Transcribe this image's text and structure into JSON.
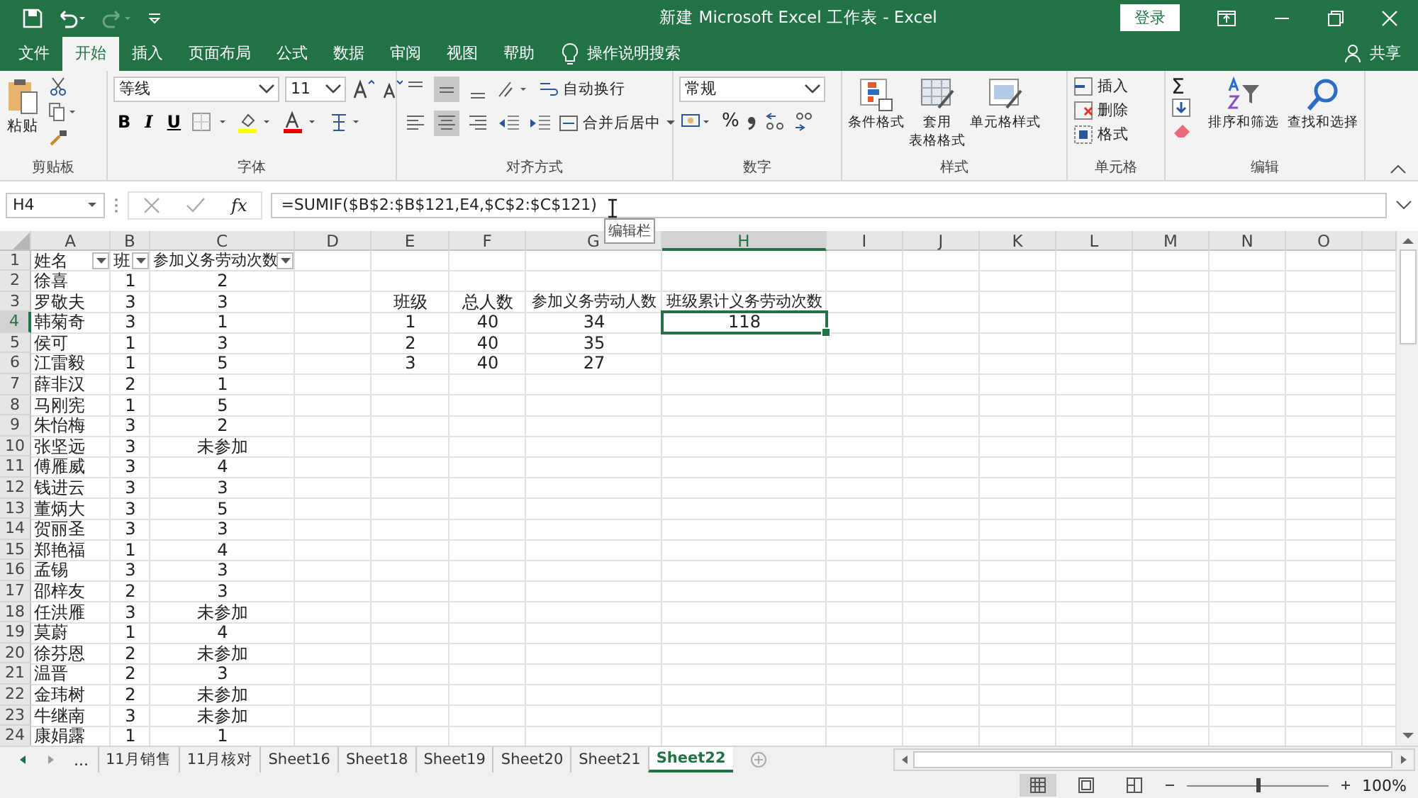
{
  "title_bar": {
    "title": "新建 Microsoft Excel 工作表  -  Excel",
    "login": "登录"
  },
  "menu_tabs": [
    {
      "label": "文件",
      "selected": false
    },
    {
      "label": "开始",
      "selected": true
    },
    {
      "label": "插入",
      "selected": false
    },
    {
      "label": "页面布局",
      "selected": false
    },
    {
      "label": "公式",
      "selected": false
    },
    {
      "label": "数据",
      "selected": false
    },
    {
      "label": "审阅",
      "selected": false
    },
    {
      "label": "视图",
      "selected": false
    },
    {
      "label": "帮助",
      "selected": false
    }
  ],
  "tell_me": "操作说明搜索",
  "share": "共享",
  "ribbon": {
    "clipboard": {
      "paste": "粘贴",
      "group": "剪贴板"
    },
    "font": {
      "name": "等线",
      "size": "11",
      "styles": [
        "B",
        "I",
        "U"
      ],
      "group": "字体"
    },
    "alignment": {
      "vertical": [
        {
          "selected": false
        },
        {
          "selected": true
        },
        {
          "selected": false
        }
      ],
      "horizontal": [
        {
          "selected": false
        },
        {
          "selected": true
        },
        {
          "selected": false
        }
      ],
      "wrap": "自动换行",
      "merge": "合并后居中",
      "group": "对齐方式"
    },
    "number": {
      "format": "常规",
      "percent": "%",
      "group": "数字"
    },
    "styles": {
      "conditional": "条件格式",
      "table_format": [
        "套用",
        "表格格式"
      ],
      "cell_styles": "单元格样式",
      "group": "样式"
    },
    "cells": {
      "insert": "插入",
      "delete": "删除",
      "format": "格式",
      "group": "单元格"
    },
    "editing": {
      "sum": "Σ",
      "sort": "排序和筛选",
      "find": "查找和选择",
      "group": "编辑"
    }
  },
  "formula_bar": {
    "name_box": "H4",
    "function_label": "fx",
    "formula": "=SUMIF($B$2:$B$121,E4,$C$2:$C$121)",
    "tooltip": "编辑栏"
  },
  "column_headers": [
    {
      "label": "A",
      "selected": false
    },
    {
      "label": "B",
      "selected": false
    },
    {
      "label": "C",
      "selected": false
    },
    {
      "label": "D",
      "selected": false
    },
    {
      "label": "E",
      "selected": false
    },
    {
      "label": "F",
      "selected": false
    },
    {
      "label": "G",
      "selected": false
    },
    {
      "label": "H",
      "selected": true
    },
    {
      "label": "I",
      "selected": false
    },
    {
      "label": "J",
      "selected": false
    },
    {
      "label": "K",
      "selected": false
    },
    {
      "label": "L",
      "selected": false
    },
    {
      "label": "M",
      "selected": false
    },
    {
      "label": "N",
      "selected": false
    },
    {
      "label": "O",
      "selected": false
    }
  ],
  "row_headers": [
    {
      "label": "1",
      "selected": false
    },
    {
      "label": "2",
      "selected": false
    },
    {
      "label": "3",
      "selected": false
    },
    {
      "label": "4",
      "selected": true
    },
    {
      "label": "5",
      "selected": false
    },
    {
      "label": "6",
      "selected": false
    },
    {
      "label": "7",
      "selected": false
    },
    {
      "label": "8",
      "selected": false
    },
    {
      "label": "9",
      "selected": false
    },
    {
      "label": "10",
      "selected": false
    },
    {
      "label": "11",
      "selected": false
    },
    {
      "label": "12",
      "selected": false
    },
    {
      "label": "13",
      "selected": false
    },
    {
      "label": "14",
      "selected": false
    },
    {
      "label": "15",
      "selected": false
    },
    {
      "label": "16",
      "selected": false
    },
    {
      "label": "17",
      "selected": false
    },
    {
      "label": "18",
      "selected": false
    },
    {
      "label": "19",
      "selected": false
    },
    {
      "label": "20",
      "selected": false
    },
    {
      "label": "21",
      "selected": false
    },
    {
      "label": "22",
      "selected": false
    },
    {
      "label": "23",
      "selected": false
    },
    {
      "label": "24",
      "selected": false
    }
  ],
  "table": {
    "header": [
      {
        "text": "姓名",
        "filter": true
      },
      {
        "text": "班",
        "filter": true
      },
      {
        "text": "参加义务劳动次数",
        "filter": true
      }
    ],
    "rows": [
      {
        "name": "徐喜",
        "class": "1",
        "count": "2"
      },
      {
        "name": "罗敬夫",
        "class": "3",
        "count": "3"
      },
      {
        "name": "韩菊奇",
        "class": "3",
        "count": "1"
      },
      {
        "name": "侯可",
        "class": "1",
        "count": "3"
      },
      {
        "name": "江雷毅",
        "class": "1",
        "count": "5"
      },
      {
        "name": "薛非汉",
        "class": "2",
        "count": "1"
      },
      {
        "name": "马刚宪",
        "class": "1",
        "count": "5"
      },
      {
        "name": "朱怡梅",
        "class": "3",
        "count": "2"
      },
      {
        "name": "张坚远",
        "class": "3",
        "count": "未参加"
      },
      {
        "name": "傅雁威",
        "class": "3",
        "count": "4"
      },
      {
        "name": "钱进云",
        "class": "3",
        "count": "3"
      },
      {
        "name": "董炳大",
        "class": "3",
        "count": "5"
      },
      {
        "name": "贺丽圣",
        "class": "3",
        "count": "3"
      },
      {
        "name": "郑艳福",
        "class": "1",
        "count": "4"
      },
      {
        "name": "孟锡",
        "class": "3",
        "count": "3"
      },
      {
        "name": "邵梓友",
        "class": "2",
        "count": "3"
      },
      {
        "name": "任洪雁",
        "class": "3",
        "count": "未参加"
      },
      {
        "name": "莫蔚",
        "class": "1",
        "count": "4"
      },
      {
        "name": "徐芬恩",
        "class": "2",
        "count": "未参加"
      },
      {
        "name": "温晋",
        "class": "2",
        "count": "3"
      },
      {
        "name": "金玮树",
        "class": "2",
        "count": "未参加"
      },
      {
        "name": "牛继南",
        "class": "3",
        "count": "未参加"
      },
      {
        "name": "康娟露",
        "class": "1",
        "count": "1"
      }
    ]
  },
  "summary": {
    "header": [
      "班级",
      "总人数",
      "参加义务劳动人数",
      "班级累计义务劳动次数"
    ],
    "rows": [
      {
        "class": "1",
        "total": "40",
        "participants": "34",
        "cumulative": "118",
        "selected": true
      },
      {
        "class": "2",
        "total": "40",
        "participants": "35"
      },
      {
        "class": "3",
        "total": "40",
        "participants": "27"
      }
    ]
  },
  "sheet_tabs": {
    "more": "...",
    "tabs": [
      {
        "label": "11月销售",
        "selected": false
      },
      {
        "label": "11月核对",
        "selected": false
      },
      {
        "label": "Sheet16",
        "selected": false
      },
      {
        "label": "Sheet18",
        "selected": false
      },
      {
        "label": "Sheet19",
        "selected": false
      },
      {
        "label": "Sheet20",
        "selected": false
      },
      {
        "label": "Sheet21",
        "selected": false
      },
      {
        "label": "Sheet22",
        "selected": true
      }
    ]
  },
  "status_bar": {
    "views": [
      {
        "selected": true
      },
      {
        "selected": false
      },
      {
        "selected": false
      }
    ],
    "zoom": {
      "level": 0.5
    },
    "zoom_label": "100%"
  }
}
